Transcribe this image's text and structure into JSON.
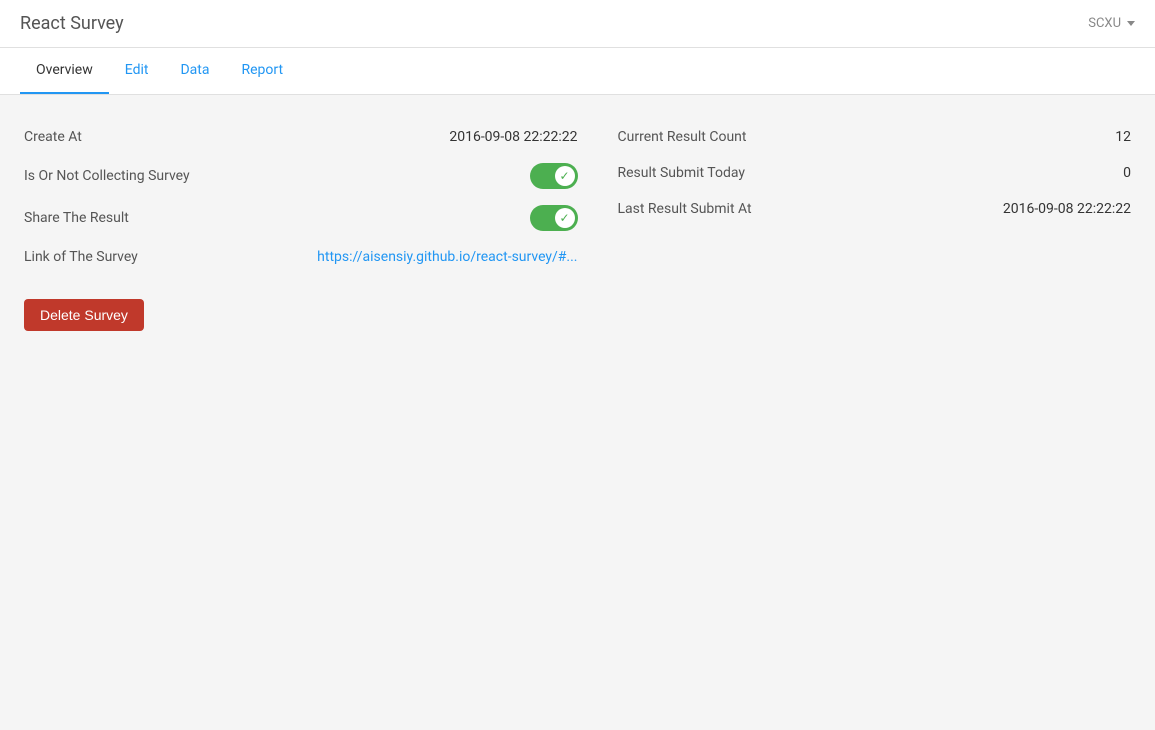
{
  "header": {
    "title": "React Survey",
    "user": "SCXU",
    "chevron": "▾"
  },
  "tabs": [
    {
      "id": "overview",
      "label": "Overview",
      "active": true
    },
    {
      "id": "edit",
      "label": "Edit",
      "active": false
    },
    {
      "id": "data",
      "label": "Data",
      "active": false
    },
    {
      "id": "report",
      "label": "Report",
      "active": false
    }
  ],
  "left_fields": [
    {
      "id": "create-at",
      "label": "Create At",
      "value": "2016-09-08 22:22:22",
      "type": "text"
    },
    {
      "id": "collecting",
      "label": "Is Or Not Collecting Survey",
      "type": "toggle",
      "checked": true
    },
    {
      "id": "share-result",
      "label": "Share The Result",
      "type": "toggle",
      "checked": true
    },
    {
      "id": "link",
      "label": "Link of The Survey",
      "value": "https://aisensiy.github.io/react-survey/#...",
      "type": "link"
    }
  ],
  "right_fields": [
    {
      "id": "result-count",
      "label": "Current Result Count",
      "value": "12"
    },
    {
      "id": "submit-today",
      "label": "Result Submit Today",
      "value": "0"
    },
    {
      "id": "last-submit",
      "label": "Last Result Submit At",
      "value": "2016-09-08 22:22:22"
    }
  ],
  "delete_button": "Delete Survey"
}
